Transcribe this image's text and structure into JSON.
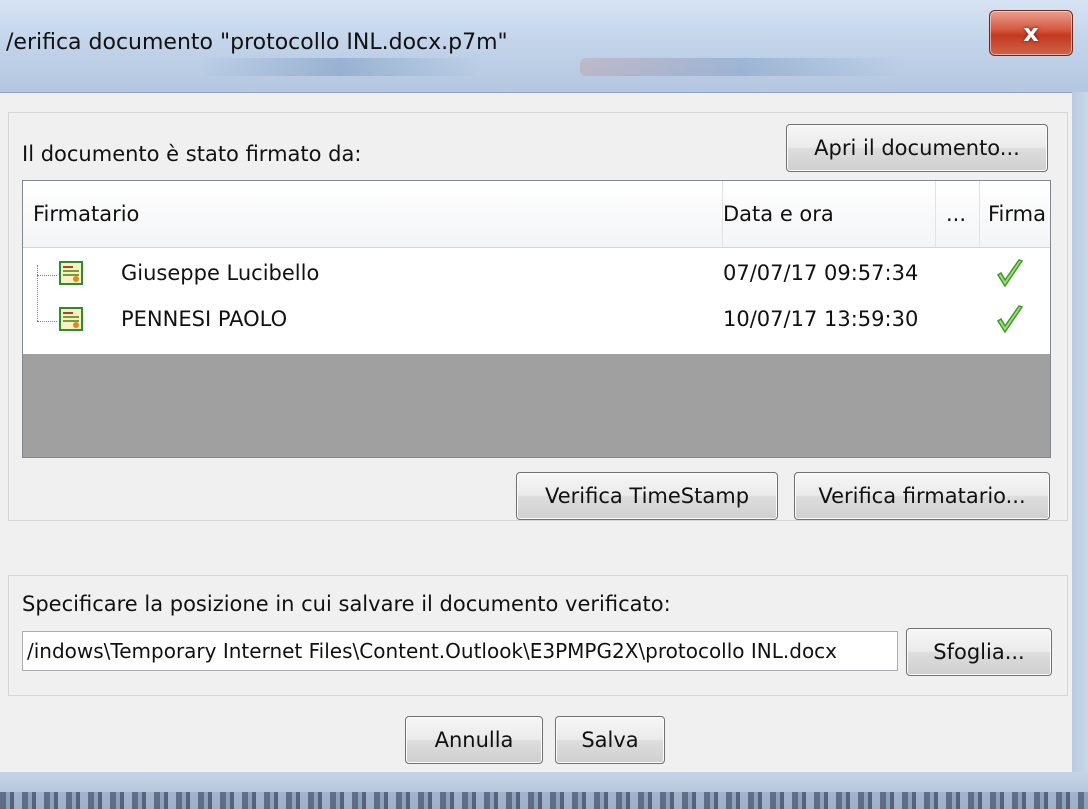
{
  "dialog": {
    "title": "/erifica documento \"protocollo INL.docx.p7m\"",
    "close_label": "x"
  },
  "signers_section": {
    "label": "Il documento è stato firmato da:",
    "open_button": "Apri il documento..."
  },
  "list": {
    "columns": [
      "Firmatario",
      "Data e ora",
      "...",
      "Firma"
    ],
    "rows": [
      {
        "name": "Giuseppe Lucibello",
        "date": "07/07/17 09:57:34",
        "signature_valid": true
      },
      {
        "name": "PENNESI PAOLO",
        "date": "10/07/17 13:59:30",
        "signature_valid": true
      }
    ]
  },
  "verify_buttons": {
    "timestamp": "Verifica TimeStamp",
    "signer": "Verifica firmatario..."
  },
  "save_section": {
    "label": "Specificare la posizione in cui salvare il documento verificato:",
    "path_value": "/indows\\Temporary Internet Files\\Content.Outlook\\E3PMPG2X\\protocollo INL.docx",
    "browse_button": "Sfoglia..."
  },
  "footer": {
    "cancel": "Annulla",
    "save": "Salva"
  },
  "icons": {
    "row_icon": "certificate-icon",
    "signature_status": "checkmark-icon",
    "close": "close-icon"
  },
  "colors": {
    "check_green": "#5fbf3a",
    "close_red": "#c94a30",
    "empty_area": "#a0a0a0"
  }
}
